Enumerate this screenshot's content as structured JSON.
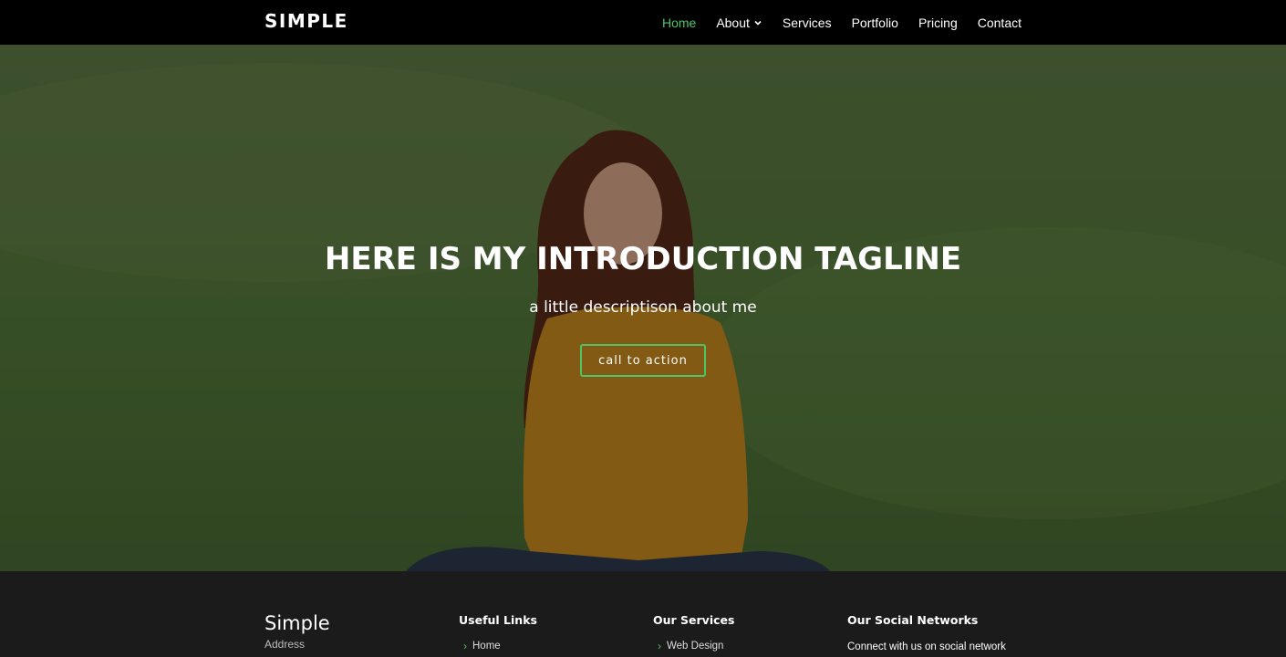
{
  "header": {
    "logo": "SIMPLE",
    "nav": [
      {
        "label": "Home",
        "active": true
      },
      {
        "label": "About",
        "dropdown": true
      },
      {
        "label": "Services"
      },
      {
        "label": "Portfolio"
      },
      {
        "label": "Pricing"
      },
      {
        "label": "Contact"
      }
    ]
  },
  "hero": {
    "title": "HERE IS MY INTRODUCTION TAGLINE",
    "subtitle": "a little descriptison about me",
    "cta_label": "call to action"
  },
  "footer": {
    "brand": "Simple",
    "address": "Address",
    "useful_links": {
      "heading": "Useful Links",
      "items": [
        "Home"
      ]
    },
    "services": {
      "heading": "Our Services",
      "items": [
        "Web Design"
      ]
    },
    "social": {
      "heading": "Our Social Networks",
      "text": "Connect with us on social network"
    }
  },
  "colors": {
    "accent": "#4cc46a",
    "header_bg": "#000000",
    "footer_bg": "#1b1b1b"
  }
}
